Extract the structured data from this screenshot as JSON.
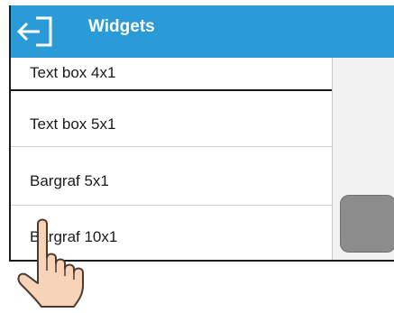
{
  "header": {
    "title": "Widgets",
    "back_icon": "back-arrow-icon",
    "background_color": "#2a9bd6"
  },
  "list": {
    "items": [
      {
        "label": "Text box 4x1"
      },
      {
        "label": "Text box 5x1"
      },
      {
        "label": "Bargraf 5x1"
      },
      {
        "label": "Bargraf 10x1"
      }
    ]
  },
  "scrollbar": {
    "thumb_color": "#8c8c8c"
  },
  "overlay": {
    "pointer_icon": "tapping-hand-icon"
  }
}
